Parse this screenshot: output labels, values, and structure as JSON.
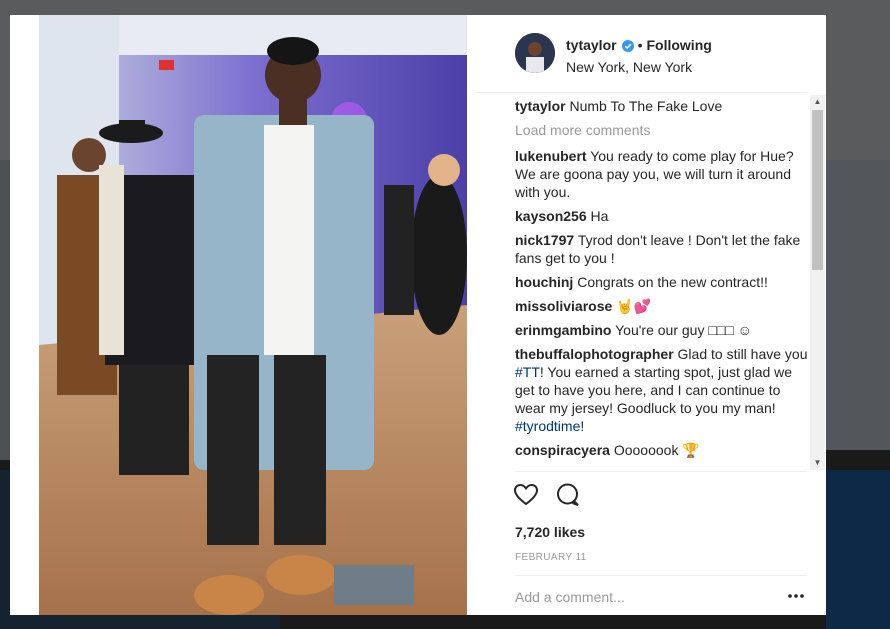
{
  "post": {
    "username": "tytaylor",
    "verified": true,
    "separator": "•",
    "follow_status": "Following",
    "location": "New York, New York"
  },
  "caption": {
    "username": "tytaylor",
    "text": "Numb To The Fake Love"
  },
  "load_more": "Load more comments",
  "comments": [
    {
      "username": "lukenubert",
      "text": "You ready to come play for Hue? We are goona pay you, we will turn it around with you."
    },
    {
      "username": "kayson256",
      "text": "Ha"
    },
    {
      "username": "nick1797",
      "text": "Tyrod don't leave ! Don't let the fake fans get to you !"
    },
    {
      "username": "houchinj",
      "text": "Congrats on the new contract!!"
    },
    {
      "username": "missoliviarose",
      "text": "🤘💕"
    },
    {
      "username": "erinmgambino",
      "text": "You're our guy □□□ ☺"
    },
    {
      "username": "thebuffalophotographer",
      "text_parts": [
        "Glad to still have you ",
        "#TT",
        "! You earned a starting spot, just glad we get to have you here, and I can continue to wear my jersey! Goodluck to you my man! ",
        "#tyrodtime",
        "!"
      ]
    },
    {
      "username": "conspiracyera",
      "text": "Oooooook 🏆"
    }
  ],
  "likes": "7,720 likes",
  "date": "FEBRUARY 11",
  "add_comment_placeholder": "Add a comment...",
  "icons": {
    "like": "heart-icon",
    "comment": "comment-bubble-icon",
    "more": "more-dots-icon",
    "verified": "verified-badge-icon"
  },
  "colors": {
    "verified_blue": "#3897f0",
    "hashtag": "#003569",
    "muted": "#999999"
  }
}
